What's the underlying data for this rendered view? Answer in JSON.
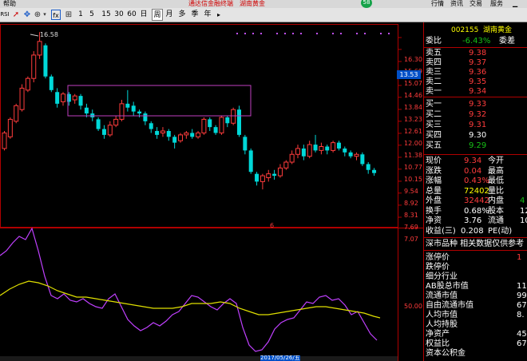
{
  "menu": {
    "help": "帮助",
    "promo": "通达信金融终端",
    "stock_title": "湖南黄金",
    "right_items": [
      "行情",
      "资讯",
      "交易",
      "服务"
    ],
    "badge": "58"
  },
  "toolbar": {
    "left_label": "RSI",
    "periods": [
      "1",
      "5",
      "15",
      "30",
      "60",
      "日",
      "周",
      "月",
      "多",
      "季",
      "年"
    ],
    "selected_period": "周"
  },
  "price_axis": {
    "labels": [
      "16.30",
      "15.69",
      "15.07",
      "14.46",
      "13.84",
      "13.23",
      "12.61",
      "12.00",
      "11.38",
      "10.77",
      "10.15",
      "9.54",
      "8.92",
      "8.31",
      "7.69",
      "7.07"
    ],
    "current": "13.53"
  },
  "main_chart": {
    "max_label": "16.58",
    "bottom_marker": "6",
    "candles": [
      {
        "o": 10.6,
        "c": 11.4,
        "h": 11.5,
        "l": 10.5
      },
      {
        "o": 11.2,
        "c": 12.1,
        "h": 12.2,
        "l": 11.1
      },
      {
        "o": 12.0,
        "c": 12.8,
        "h": 12.9,
        "l": 11.9
      },
      {
        "o": 12.6,
        "c": 13.7,
        "h": 13.9,
        "l": 12.5
      },
      {
        "o": 13.6,
        "c": 14.2,
        "h": 14.3,
        "l": 13.5
      },
      {
        "o": 14.2,
        "c": 15.4,
        "h": 15.6,
        "l": 14.0
      },
      {
        "o": 15.4,
        "c": 16.1,
        "h": 16.58,
        "l": 15.2
      },
      {
        "o": 15.9,
        "c": 14.3,
        "h": 16.0,
        "l": 14.2
      },
      {
        "o": 14.3,
        "c": 13.6,
        "h": 14.4,
        "l": 13.5
      },
      {
        "o": 13.5,
        "c": 12.9,
        "h": 13.7,
        "l": 12.7
      },
      {
        "o": 13.0,
        "c": 13.4,
        "h": 13.5,
        "l": 12.8
      },
      {
        "o": 13.4,
        "c": 13.0,
        "h": 13.5,
        "l": 12.8
      },
      {
        "o": 13.1,
        "c": 13.3,
        "h": 13.4,
        "l": 12.9
      },
      {
        "o": 13.3,
        "c": 12.8,
        "h": 13.4,
        "l": 12.6
      },
      {
        "o": 12.7,
        "c": 12.4,
        "h": 12.9,
        "l": 12.2
      },
      {
        "o": 12.4,
        "c": 12.2,
        "h": 12.6,
        "l": 12.0
      },
      {
        "o": 12.1,
        "c": 11.6,
        "h": 12.2,
        "l": 11.5
      },
      {
        "o": 11.6,
        "c": 11.3,
        "h": 11.8,
        "l": 11.1
      },
      {
        "o": 11.3,
        "c": 11.8,
        "h": 12.0,
        "l": 11.2
      },
      {
        "o": 11.8,
        "c": 12.1,
        "h": 12.3,
        "l": 11.7
      },
      {
        "o": 12.1,
        "c": 12.9,
        "h": 13.1,
        "l": 12.0
      },
      {
        "o": 12.9,
        "c": 12.7,
        "h": 13.6,
        "l": 12.5
      },
      {
        "o": 12.8,
        "c": 12.5,
        "h": 13.0,
        "l": 12.3
      },
      {
        "o": 12.5,
        "c": 12.4,
        "h": 12.6,
        "l": 12.2
      },
      {
        "o": 12.4,
        "c": 12.0,
        "h": 12.5,
        "l": 11.8
      },
      {
        "o": 11.9,
        "c": 11.6,
        "h": 12.0,
        "l": 11.4
      },
      {
        "o": 11.5,
        "c": 11.3,
        "h": 11.7,
        "l": 11.1
      },
      {
        "o": 11.4,
        "c": 11.5,
        "h": 11.7,
        "l": 11.2
      },
      {
        "o": 11.5,
        "c": 11.2,
        "h": 11.6,
        "l": 11.0
      },
      {
        "o": 11.2,
        "c": 10.9,
        "h": 11.3,
        "l": 10.6
      },
      {
        "o": 11.0,
        "c": 11.3,
        "h": 11.4,
        "l": 10.9
      },
      {
        "o": 11.3,
        "c": 11.4,
        "h": 11.5,
        "l": 11.1
      },
      {
        "o": 11.4,
        "c": 11.2,
        "h": 11.6,
        "l": 11.1
      },
      {
        "o": 11.2,
        "c": 11.4,
        "h": 11.5,
        "l": 11.1
      },
      {
        "o": 11.4,
        "c": 12.1,
        "h": 12.2,
        "l": 11.3
      },
      {
        "o": 12.1,
        "c": 11.7,
        "h": 12.2,
        "l": 11.5
      },
      {
        "o": 11.7,
        "c": 11.4,
        "h": 11.8,
        "l": 11.3
      },
      {
        "o": 11.4,
        "c": 12.2,
        "h": 12.3,
        "l": 11.3
      },
      {
        "o": 12.2,
        "c": 11.9,
        "h": 12.3,
        "l": 11.7
      },
      {
        "o": 11.9,
        "c": 12.6,
        "h": 12.7,
        "l": 11.8
      },
      {
        "o": 12.6,
        "c": 11.3,
        "h": 12.8,
        "l": 11.2
      },
      {
        "o": 11.2,
        "c": 10.5,
        "h": 11.3,
        "l": 10.3
      },
      {
        "o": 10.5,
        "c": 9.4,
        "h": 10.6,
        "l": 9.3
      },
      {
        "o": 9.3,
        "c": 8.9,
        "h": 9.4,
        "l": 8.7
      },
      {
        "o": 8.9,
        "c": 9.2,
        "h": 9.3,
        "l": 8.5
      },
      {
        "o": 9.1,
        "c": 9.3,
        "h": 9.5,
        "l": 8.9
      },
      {
        "o": 9.3,
        "c": 9.2,
        "h": 9.5,
        "l": 9.0
      },
      {
        "o": 9.2,
        "c": 9.6,
        "h": 9.8,
        "l": 9.1
      },
      {
        "o": 9.6,
        "c": 9.9,
        "h": 10.0,
        "l": 9.5
      },
      {
        "o": 9.9,
        "c": 10.3,
        "h": 10.5,
        "l": 9.8
      },
      {
        "o": 10.3,
        "c": 10.6,
        "h": 10.8,
        "l": 10.1
      },
      {
        "o": 10.6,
        "c": 10.2,
        "h": 10.8,
        "l": 10.0
      },
      {
        "o": 10.2,
        "c": 10.8,
        "h": 11.0,
        "l": 10.1
      },
      {
        "o": 10.8,
        "c": 10.5,
        "h": 11.3,
        "l": 10.4
      },
      {
        "o": 10.5,
        "c": 10.7,
        "h": 10.9,
        "l": 10.3
      },
      {
        "o": 10.7,
        "c": 10.5,
        "h": 10.8,
        "l": 10.3
      },
      {
        "o": 10.5,
        "c": 10.9,
        "h": 11.0,
        "l": 10.4
      },
      {
        "o": 10.9,
        "c": 10.6,
        "h": 11.0,
        "l": 10.5
      },
      {
        "o": 10.6,
        "c": 10.4,
        "h": 10.7,
        "l": 10.2
      },
      {
        "o": 10.4,
        "c": 10.2,
        "h": 10.5,
        "l": 10.1
      },
      {
        "o": 10.2,
        "c": 10.3,
        "h": 10.4,
        "l": 10.0
      },
      {
        "o": 10.3,
        "c": 9.8,
        "h": 10.4,
        "l": 9.7
      },
      {
        "o": 9.8,
        "c": 9.5,
        "h": 9.9,
        "l": 9.3
      },
      {
        "o": 9.5,
        "c": 9.34,
        "h": 9.6,
        "l": 9.2
      }
    ]
  },
  "indicator": {
    "axis_label": "50.00",
    "date_label": "2017/05/26/五"
  },
  "quote": {
    "code": "002155",
    "name": "湖南黄金",
    "webi_label": "委比",
    "webi_value": "-6.43%",
    "weicha_label": "委差",
    "sells": [
      {
        "label": "卖五",
        "price": "9.38"
      },
      {
        "label": "卖四",
        "price": "9.37"
      },
      {
        "label": "卖三",
        "price": "9.36"
      },
      {
        "label": "卖二",
        "price": "9.35"
      },
      {
        "label": "卖一",
        "price": "9.34"
      }
    ],
    "buys": [
      {
        "label": "买一",
        "price": "9.33"
      },
      {
        "label": "买二",
        "price": "9.32"
      },
      {
        "label": "买三",
        "price": "9.31"
      },
      {
        "label": "买四",
        "price": "9.30"
      },
      {
        "label": "买五",
        "price": "9.29"
      }
    ],
    "stats": [
      {
        "l1": "现价",
        "v1": "9.34",
        "l2": "今开",
        "v2": ""
      },
      {
        "l1": "涨跌",
        "v1": "0.04",
        "l2": "最高",
        "v2": ""
      },
      {
        "l1": "涨幅",
        "v1": "0.43%",
        "l2": "最低",
        "v2": ""
      },
      {
        "l1": "总量",
        "v1": "72402",
        "l2": "量比",
        "v2": ""
      },
      {
        "l1": "外盘",
        "v1": "32442",
        "l2": "内盘",
        "v2": "4"
      },
      {
        "l1": "换手",
        "v1": "0.68%",
        "l2": "股本",
        "v2": "12"
      },
      {
        "l1": "净资",
        "v1": "3.76",
        "l2": "流通",
        "v2": "10"
      },
      {
        "l1": "收益(三)",
        "v1": "0.208",
        "l2": "PE(动)",
        "v2": ""
      }
    ],
    "info_header": "深市品种  相关数据仅供参考",
    "info_rows": [
      {
        "label": "涨停价",
        "value": "1"
      },
      {
        "label": "跌停价",
        "value": ""
      },
      {
        "label": "细分行业",
        "value": ""
      },
      {
        "label": "AB股总市值",
        "value": "112"
      },
      {
        "label": "流通市值",
        "value": "99"
      },
      {
        "label": "自由流通市值",
        "value": "67"
      },
      {
        "label": "人均市值",
        "value": "8."
      },
      {
        "label": "人均持股",
        "value": ""
      },
      {
        "label": "净资产",
        "value": "45."
      },
      {
        "label": "权益比",
        "value": "67"
      },
      {
        "label": "资本公积金",
        "value": ""
      }
    ]
  }
}
